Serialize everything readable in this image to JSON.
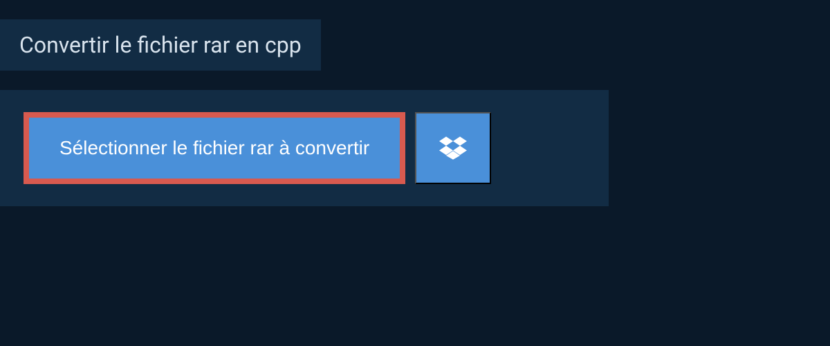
{
  "header": {
    "title": "Convertir le fichier rar en cpp"
  },
  "buttons": {
    "select_file_label": "Sélectionner le fichier rar à convertir"
  },
  "colors": {
    "background": "#0a1929",
    "panel": "#122c44",
    "button_primary": "#4a90d9",
    "button_highlight_border": "#d85a4f",
    "text_light": "#d8e3ed",
    "text_white": "#ffffff"
  }
}
